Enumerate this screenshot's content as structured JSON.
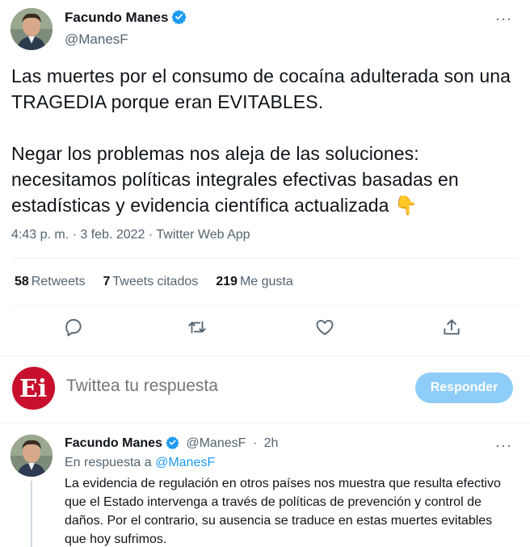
{
  "tweet": {
    "author_name": "Facundo Manes",
    "author_handle": "@ManesF",
    "more_label": "···",
    "paragraph1": "Las muertes por el consumo de cocaína adulterada son una TRAGEDIA porque eran EVITABLES.",
    "paragraph2": "Negar los problemas nos aleja de las soluciones: necesitamos políticas integrales efectivas basadas en estadísticas y evidencia científica actualizada",
    "emoji": "👇",
    "timestamp": "4:43 p. m. · 3 feb. 2022 · Twitter Web App"
  },
  "stats": {
    "retweets_count": "58",
    "retweets_label": "Retweets",
    "quotes_count": "7",
    "quotes_label": "Tweets citados",
    "likes_count": "219",
    "likes_label": "Me gusta"
  },
  "actions": {
    "icons": [
      "reply-icon",
      "retweet-icon",
      "like-icon",
      "share-icon"
    ]
  },
  "compose": {
    "placeholder": "Twittea tu respuesta",
    "button_label": "Responder",
    "avatar_text": "Ei"
  },
  "reply": {
    "author_name": "Facundo Manes",
    "author_handle": "@ManesF",
    "separator": "·",
    "time": "2h",
    "more_label": "···",
    "replying_prefix": "En respuesta a",
    "replying_handle": "@ManesF",
    "text": "La evidencia de regulación en otros países nos muestra que resulta efectivo que el Estado intervenga a través de políticas de prevención y control de daños. Por el contrario, su ausencia se traduce en estas muertes evitables que hoy sufrimos."
  },
  "colors": {
    "accent": "#1d9bf0",
    "button_disabled": "#8ecdf8",
    "secondary_text": "#536471",
    "brand_red": "#c8102e"
  }
}
